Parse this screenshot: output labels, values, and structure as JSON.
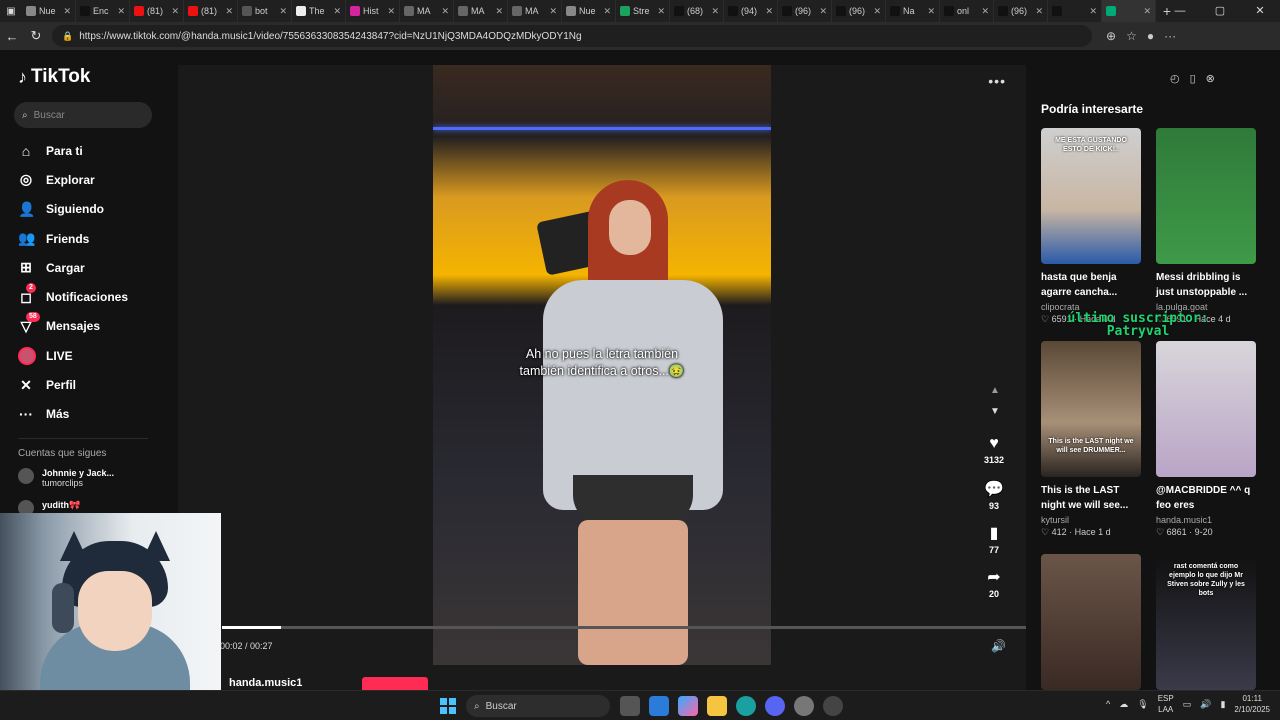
{
  "browser": {
    "tabs": [
      {
        "label": "Nue",
        "color": "#888"
      },
      {
        "label": "Enc",
        "color": "#111"
      },
      {
        "label": "(81)",
        "color": "#e11"
      },
      {
        "label": "(81)",
        "color": "#e11"
      },
      {
        "label": "bot",
        "color": "#555"
      },
      {
        "label": "The",
        "color": "#eee"
      },
      {
        "label": "Hist",
        "color": "#d6249f"
      },
      {
        "label": "MA",
        "color": "#666"
      },
      {
        "label": "MA",
        "color": "#666"
      },
      {
        "label": "MA",
        "color": "#666"
      },
      {
        "label": "Nue",
        "color": "#888"
      },
      {
        "label": "Stre",
        "color": "#1aa260"
      },
      {
        "label": "(68)",
        "color": "#111"
      },
      {
        "label": "(94)",
        "color": "#111"
      },
      {
        "label": "(96)",
        "color": "#111"
      },
      {
        "label": "(96)",
        "color": "#111"
      },
      {
        "label": "Na",
        "color": "#111"
      },
      {
        "label": "onl",
        "color": "#111"
      },
      {
        "label": "(96)",
        "color": "#111"
      },
      {
        "label": "",
        "color": "#111"
      },
      {
        "label": "",
        "color": "#0a7"
      }
    ],
    "url": "https://www.tiktok.com/@handa.music1/video/7556363308354243847?cid=NzU1NjQ3MDA4ODQzMDkyODY1Ng"
  },
  "tiktok": {
    "logo": "TikTok",
    "search_placeholder": "Buscar",
    "nav": [
      {
        "label": "Para ti",
        "icon": "home-icon",
        "glyph": "⌂"
      },
      {
        "label": "Explorar",
        "icon": "compass-icon",
        "glyph": "◎"
      },
      {
        "label": "Siguiendo",
        "icon": "following-icon",
        "glyph": "👤"
      },
      {
        "label": "Friends",
        "icon": "friends-icon",
        "glyph": "👥"
      },
      {
        "label": "Cargar",
        "icon": "upload-icon",
        "glyph": "⊞"
      },
      {
        "label": "Notificaciones",
        "icon": "bell-icon",
        "glyph": "◻",
        "badge": "2"
      },
      {
        "label": "Mensajes",
        "icon": "messages-icon",
        "glyph": "▽",
        "badge": "58"
      },
      {
        "label": "LIVE",
        "icon": "live-icon",
        "glyph": ""
      },
      {
        "label": "Perfil",
        "icon": "profile-icon",
        "glyph": "✕"
      },
      {
        "label": "Más",
        "icon": "more-icon",
        "glyph": "···"
      }
    ],
    "following_title": "Cuentas que sigues",
    "following": [
      {
        "name": "Johnnie y Jack...",
        "sub": "tumorclips"
      },
      {
        "name": "yudith🎀",
        "sub": ""
      }
    ],
    "video": {
      "caption_line1": "Ah no pues la letra también",
      "caption_line2": "también identifica a otros...🤢",
      "likes": "3132",
      "comments": "93",
      "saves": "77",
      "shares": "20",
      "time": "00:02 / 00:27",
      "progress_fraction": 0.074,
      "author": "handa.music1"
    },
    "recommendations_title": "Podría interesarte",
    "recommendations": [
      {
        "title1": "hasta que benja",
        "title2": "agarre cancha...",
        "user": "clipocrata",
        "stats": "♡ 6591 · Hace 4 d",
        "thumb_text": "ME ESTA GUSTANDO ESTO DE KICK!.."
      },
      {
        "title1": "Messi dribbling is",
        "title2": "just unstoppable ...",
        "user": "la.pulga.goat",
        "stats": "♡ 6591 · Hace 4 d",
        "thumb_text": ""
      },
      {
        "title1": "This is the LAST",
        "title2": "night we will see...",
        "user": "kytursil",
        "stats": "♡ 412 · Hace 1 d",
        "thumb_text": "This is the LAST night we will see DRUMMER..."
      },
      {
        "title1": "@MACBRIDDE ^^ q",
        "title2": "feo eres",
        "user": "handa.music1",
        "stats": "♡ 6861 · 9-20",
        "thumb_text": ""
      },
      {
        "title1": "",
        "title2": "",
        "user": "",
        "stats": "",
        "thumb_text": ""
      },
      {
        "title1": "",
        "title2": "",
        "user": "",
        "stats": "",
        "thumb_text": "rast comentá como ejemplo lo que dijo Mr Stiven sobre Zully y les bots"
      }
    ]
  },
  "stream_overlay": {
    "line1": "último suscriptor:",
    "line2": "Patryval"
  },
  "taskbar": {
    "search": "Buscar",
    "lang1": "ESP",
    "lang2": "LAA",
    "time": "01:11",
    "date": "2/10/2025"
  }
}
